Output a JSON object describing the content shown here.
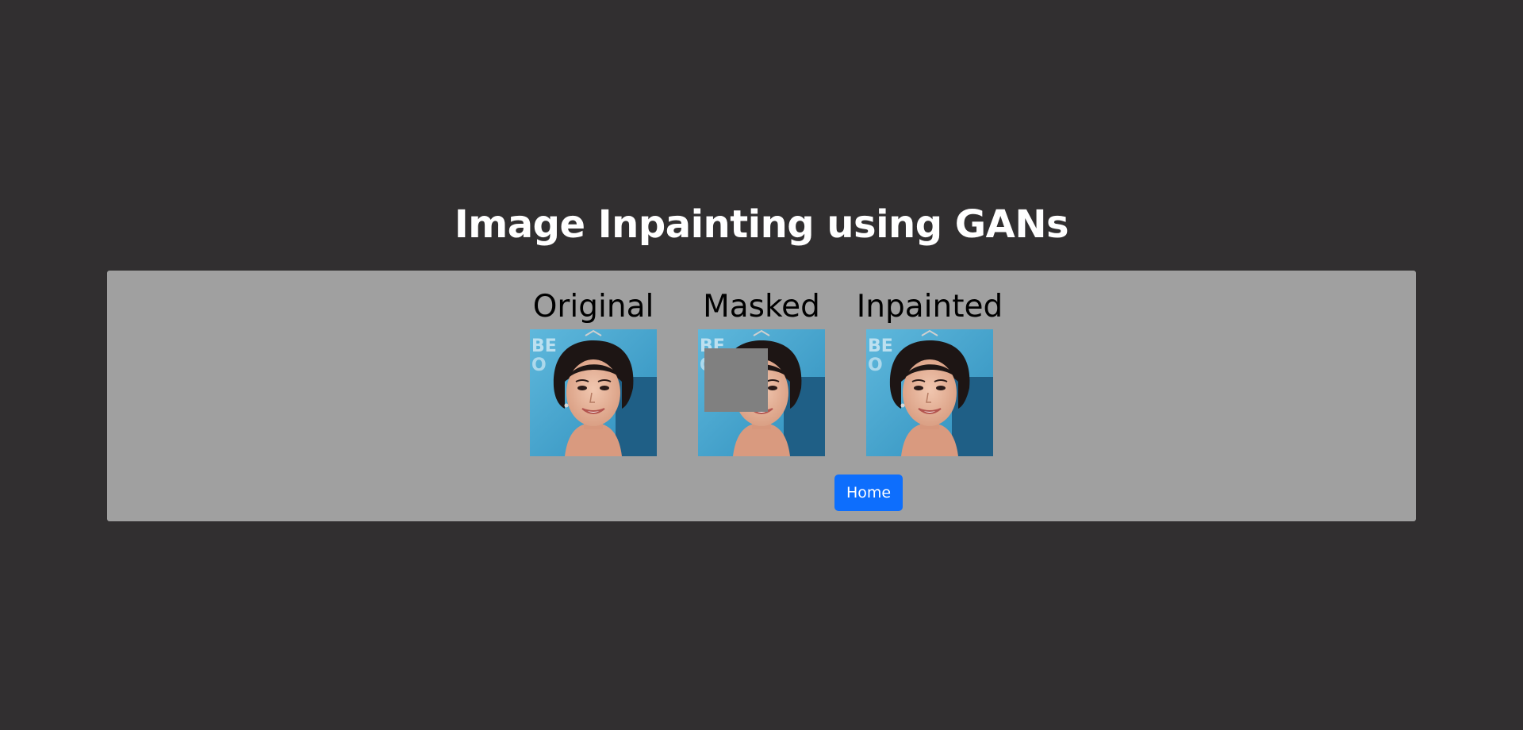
{
  "page": {
    "title": "Image Inpainting using GANs"
  },
  "gallery": {
    "items": [
      {
        "caption": "Original"
      },
      {
        "caption": "Masked"
      },
      {
        "caption": "Inpainted"
      }
    ]
  },
  "actions": {
    "home_label": "Home"
  },
  "colors": {
    "background": "#312f30",
    "panel": "#a0a0a0",
    "accent": "#0d6efd",
    "mask": "#808080"
  }
}
